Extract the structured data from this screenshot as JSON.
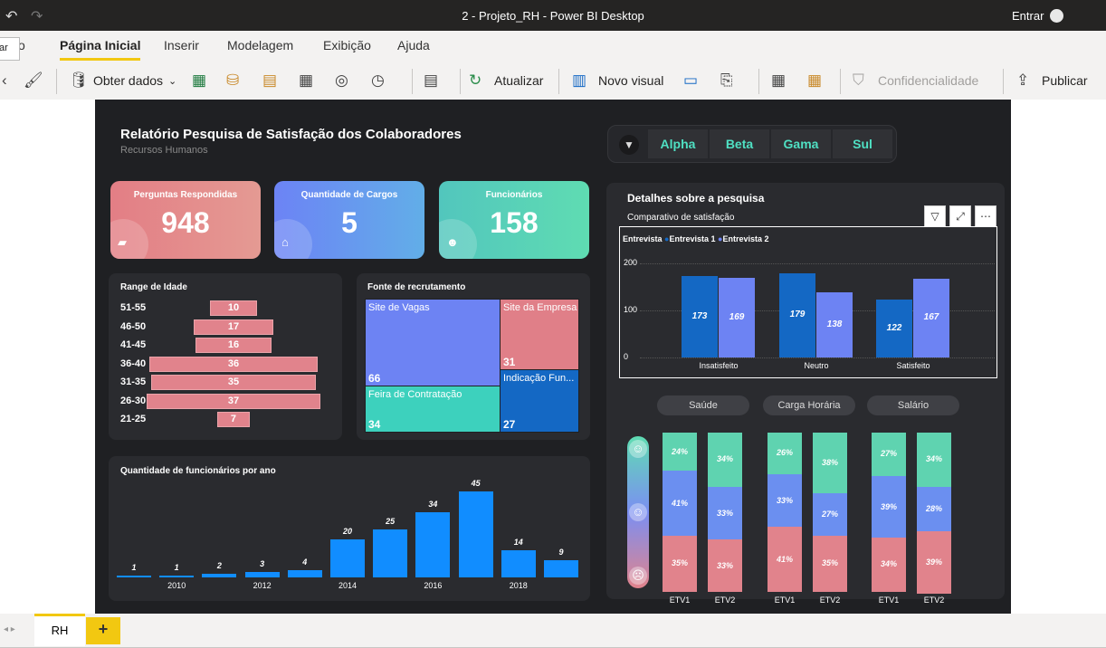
{
  "window": {
    "title": "2 - Projeto_RH - Power BI Desktop",
    "sign_in": "Entrar"
  },
  "tooltip": "ar",
  "tabs": [
    "o",
    "Página Inicial",
    "Inserir",
    "Modelagem",
    "Exibição",
    "Ajuda"
  ],
  "ribbon": {
    "get_data": "Obter dados",
    "refresh": "Atualizar",
    "new_visual": "Novo visual",
    "sensitivity": "Confidencialidade",
    "publish": "Publicar"
  },
  "report": {
    "title": "Relatório Pesquisa de Satisfação dos Colaboradores",
    "subtitle": "Recursos Humanos"
  },
  "slicer": [
    "Alpha",
    "Beta",
    "Gama",
    "Sul"
  ],
  "kpis": [
    {
      "label": "Perguntas Respondidas",
      "value": "948",
      "color_from": "#e37e85",
      "color_to": "#e49a93"
    },
    {
      "label": "Quantidade de Cargos",
      "value": "5",
      "color_from": "#6c83f5",
      "color_to": "#62aee8"
    },
    {
      "label": "Funcionários",
      "value": "158",
      "color_from": "#52c6bd",
      "color_to": "#5fdcb2"
    }
  ],
  "age": {
    "title": "Range de Idade",
    "rows": [
      {
        "label": "51-55",
        "value": 10
      },
      {
        "label": "46-50",
        "value": 17
      },
      {
        "label": "41-45",
        "value": 16
      },
      {
        "label": "36-40",
        "value": 36
      },
      {
        "label": "31-35",
        "value": 35
      },
      {
        "label": "26-30",
        "value": 37
      },
      {
        "label": "21-25",
        "value": 7
      }
    ]
  },
  "recruit": {
    "title": "Fonte de recrutamento",
    "items": [
      {
        "name": "Site de Vagas",
        "value": 66,
        "color": "#6d83f3"
      },
      {
        "name": "Site da Empresa",
        "value": 31,
        "color": "#e07f88"
      },
      {
        "name": "Indicação Fun...",
        "value": 27,
        "color": "#1468c4"
      },
      {
        "name": "Feira de Contratação",
        "value": 34,
        "color": "#3dd1bd"
      }
    ]
  },
  "years": {
    "title": "Quantidade de funcionários por ano",
    "values": [
      1,
      1,
      2,
      3,
      4,
      20,
      25,
      34,
      45,
      14,
      9
    ],
    "xlabels": [
      "",
      "2010",
      "",
      "2012",
      "",
      "2014",
      "",
      "2016",
      "",
      "2018",
      ""
    ]
  },
  "details": {
    "title": "Detalhes sobre a pesquisa",
    "chart_title": "Comparativo de satisfação"
  },
  "chart_data": {
    "type": "bar",
    "title": "Comparativo de satisfação",
    "legend_title": "Entrevista",
    "categories": [
      "Insatisfeito",
      "Neutro",
      "Satisfeito"
    ],
    "series": [
      {
        "name": "Entrevista 1",
        "values": [
          173,
          179,
          122
        ],
        "color": "#1468c4"
      },
      {
        "name": "Entrevista 2",
        "values": [
          169,
          138,
          167
        ],
        "color": "#6d83f3"
      }
    ],
    "yticks": [
      "0",
      "100",
      "200"
    ],
    "ylim": [
      0,
      230
    ]
  },
  "pills": [
    "Saúde",
    "Carga Horária",
    "Salário"
  ],
  "stacks": [
    {
      "label": "ETV1",
      "top": "24%",
      "mid": "41%",
      "bot": "35%",
      "t": 24,
      "m": 41,
      "b": 35
    },
    {
      "label": "ETV2",
      "top": "34%",
      "mid": "33%",
      "bot": "33%",
      "t": 34,
      "m": 33,
      "b": 33
    },
    {
      "label": "ETV1",
      "top": "26%",
      "mid": "33%",
      "bot": "41%",
      "t": 26,
      "m": 33,
      "b": 41
    },
    {
      "label": "ETV2",
      "top": "38%",
      "mid": "27%",
      "bot": "35%",
      "t": 38,
      "m": 27,
      "b": 35
    },
    {
      "label": "ETV1",
      "top": "27%",
      "mid": "39%",
      "bot": "34%",
      "t": 27,
      "m": 39,
      "b": 34
    },
    {
      "label": "ETV2",
      "top": "34%",
      "mid": "28%",
      "bot": "39%",
      "t": 34,
      "m": 28,
      "b": 39
    }
  ],
  "sheet_tab": "RH",
  "add_sheet": "+"
}
